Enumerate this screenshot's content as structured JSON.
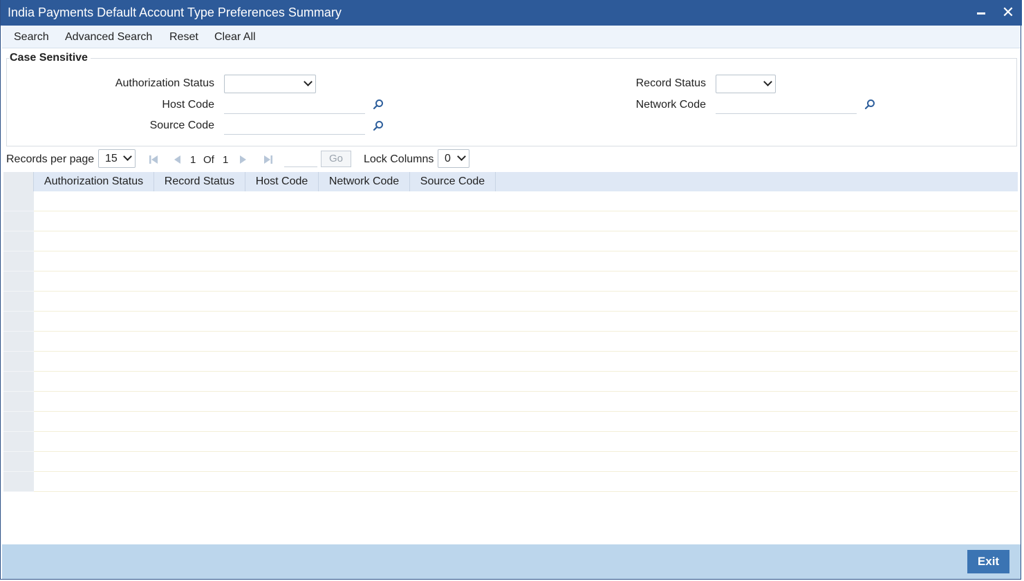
{
  "window": {
    "title": "India Payments Default Account Type Preferences Summary"
  },
  "toolbar": {
    "search": "Search",
    "advanced_search": "Advanced Search",
    "reset": "Reset",
    "clear_all": "Clear All"
  },
  "criteria": {
    "legend": "Case Sensitive",
    "authorization_status_label": "Authorization Status",
    "authorization_status_value": "",
    "record_status_label": "Record Status",
    "record_status_value": "",
    "host_code_label": "Host Code",
    "host_code_value": "",
    "network_code_label": "Network Code",
    "network_code_value": "",
    "source_code_label": "Source Code",
    "source_code_value": ""
  },
  "pager": {
    "records_per_page_label": "Records per page",
    "records_per_page_value": "15",
    "current_page": "1",
    "of_label": "Of",
    "total_pages": "1",
    "go_label": "Go",
    "lock_columns_label": "Lock Columns",
    "lock_columns_value": "0"
  },
  "grid": {
    "columns": [
      "Authorization Status",
      "Record Status",
      "Host Code",
      "Network Code",
      "Source Code"
    ],
    "row_count": 15
  },
  "footer": {
    "exit_label": "Exit"
  },
  "colors": {
    "titlebar": "#2d5a99",
    "toolbar_bg": "#eef4fb",
    "grid_header": "#dfe8f5",
    "footer_bg": "#bcd6ec",
    "exit_button": "#3b74b3"
  }
}
